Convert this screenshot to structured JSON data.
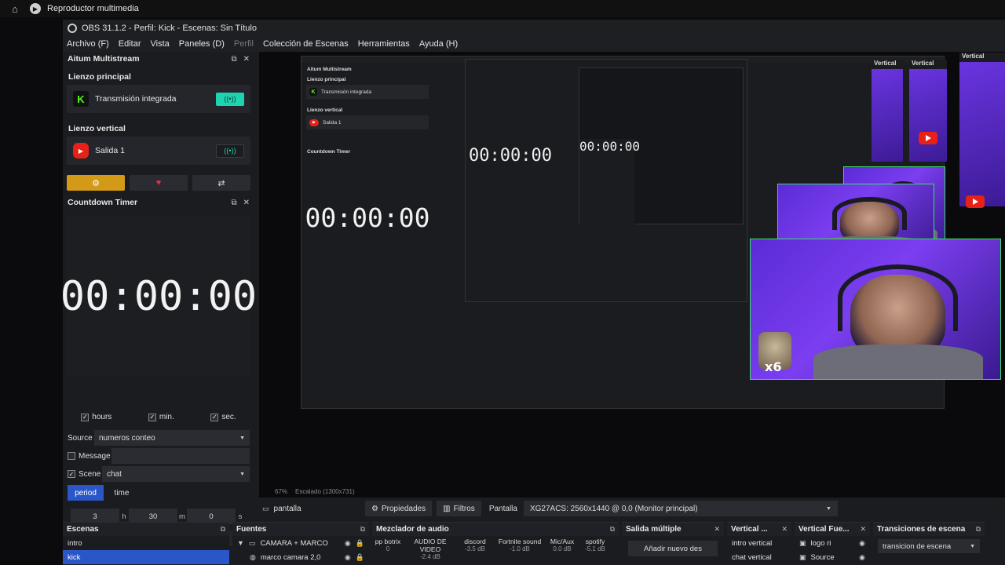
{
  "media_bar": {
    "title": "Reproductor multimedia"
  },
  "window": {
    "title": "OBS 31.1.2 - Perfil: Kick - Escenas: Sin Título"
  },
  "menu": [
    "Archivo (F)",
    "Editar",
    "Vista",
    "Paneles (D)",
    "Perfil",
    "Colección de Escenas",
    "Herramientas",
    "Ayuda (H)"
  ],
  "multistream": {
    "title": "Aitum Multistream",
    "main_label": "Lienzo principal",
    "main_service": "Transmisión integrada",
    "vertical_label": "Lienzo vertical",
    "vertical_service": "Salida 1"
  },
  "countdown": {
    "title": "Countdown Timer",
    "display": "00:00:00",
    "hours_label": "hours",
    "min_label": "min.",
    "sec_label": "sec.",
    "source_label": "Source",
    "source_value": "numeros conteo",
    "message_label": "Message",
    "scene_label": "Scene",
    "scene_value": "chat",
    "tab_period": "period",
    "tab_time": "time",
    "hours_value": "3",
    "hours_unit": "h",
    "minutes_value": "30",
    "minutes_unit": "m",
    "seconds_value": "0",
    "seconds_unit": "s"
  },
  "preview": {
    "vertical_label": "Vertical",
    "nested_timer": "00:00:00",
    "cat_overlay": "x6"
  },
  "status": {
    "zoom": "67%",
    "scale": "Escalado (1300x731)"
  },
  "controls": {
    "scene_name": "pantalla",
    "properties": "Propiedades",
    "filters": "Filtros",
    "display_label": "Pantalla",
    "monitor": "XG27ACS: 2560x1440 @ 0,0 (Monitor principal)"
  },
  "docks": {
    "scenes": {
      "title": "Escenas",
      "items": [
        "intro",
        "kick"
      ]
    },
    "sources": {
      "title": "Fuentes",
      "items": [
        "CAMARA + MARCO",
        "marco camara 2,0"
      ]
    },
    "mixer": {
      "title": "Mezclador de audio",
      "channels": [
        {
          "name": "pp botrix",
          "db": "0"
        },
        {
          "name": "AUDIO DE VIDEO",
          "db": "-2.4 dB"
        },
        {
          "name": "discord",
          "db": "-3.5 dB"
        },
        {
          "name": "Fortnite sound",
          "db": "-1.0 dB"
        },
        {
          "name": "Mic/Aux",
          "db": "0.0 dB"
        },
        {
          "name": "spotify",
          "db": "-5.1 dB"
        }
      ]
    },
    "multi_output": {
      "title": "Salida múltiple",
      "add": "Añadir nuevo des"
    },
    "vertical_scenes": {
      "title": "Vertical ...",
      "items": [
        "intro vertical",
        "chat vertical"
      ]
    },
    "vertical_sources": {
      "title": "Vertical Fue...",
      "items": [
        "logo ri",
        "Source"
      ]
    },
    "transitions": {
      "title": "Transiciones de escena",
      "value": "transicion de escena"
    }
  }
}
